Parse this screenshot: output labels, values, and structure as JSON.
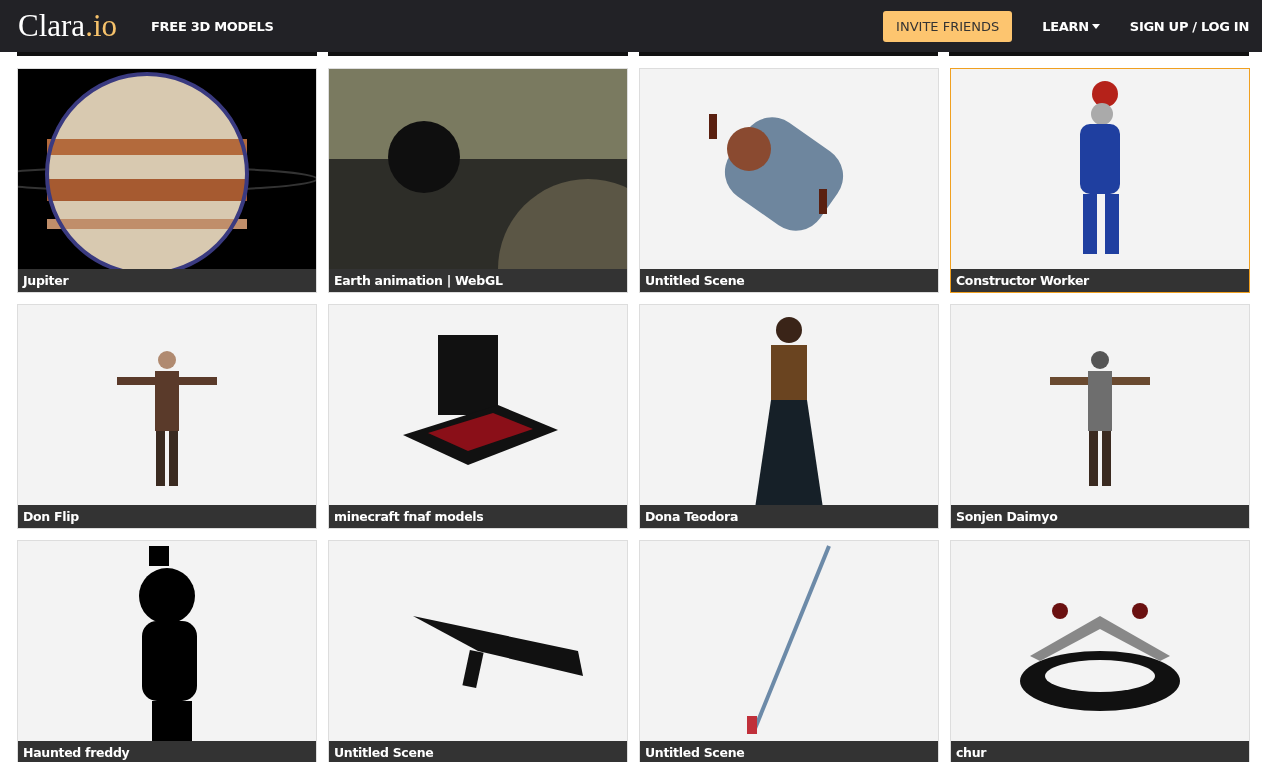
{
  "header": {
    "logo_main": "Clara",
    "logo_accent": ".io",
    "nav_left": "FREE 3D MODELS",
    "invite_button": "INVITE FRIENDS",
    "learn_menu": "LEARN",
    "auth_link": "SIGN UP / LOG IN"
  },
  "models": [
    {
      "title": "Jupiter",
      "selected": false,
      "kind": "picture"
    },
    {
      "title": "Earth animation | WebGL",
      "selected": false,
      "kind": "picture"
    },
    {
      "title": "Untitled Scene",
      "selected": false,
      "kind": "picture"
    },
    {
      "title": "Constructor Worker",
      "selected": true,
      "kind": "picture"
    },
    {
      "title": "Don Flip",
      "selected": false,
      "kind": "picture"
    },
    {
      "title": "minecraft fnaf models",
      "selected": false,
      "kind": "picture"
    },
    {
      "title": "Dona Teodora",
      "selected": false,
      "kind": "picture"
    },
    {
      "title": "Sonjen Daimyo",
      "selected": false,
      "kind": "picture"
    },
    {
      "title": "Haunted freddy",
      "selected": false,
      "kind": "picture"
    },
    {
      "title": "Untitled Scene",
      "selected": false,
      "kind": "picture"
    },
    {
      "title": "Untitled Scene",
      "selected": false,
      "kind": "picture"
    },
    {
      "title": "chur",
      "selected": false,
      "kind": "picture"
    }
  ]
}
